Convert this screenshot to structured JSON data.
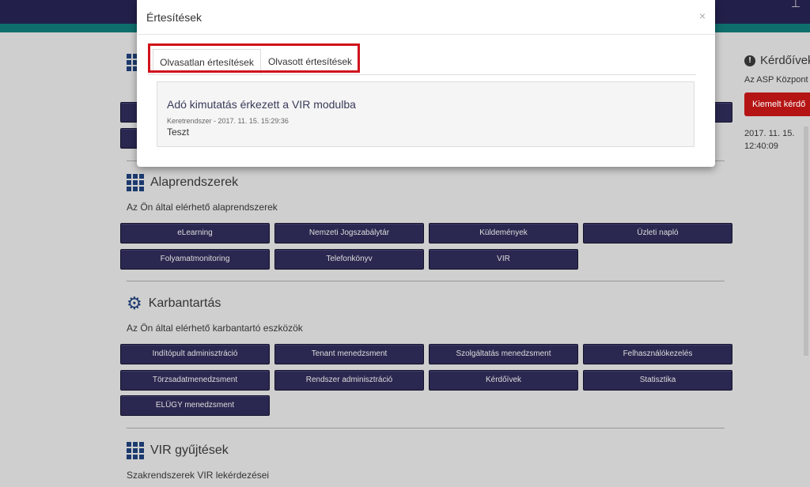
{
  "modal": {
    "title": "Értesítések",
    "close": "×",
    "tabs": [
      {
        "label": "Olvasatlan értesítések"
      },
      {
        "label": "Olvasott értesítések"
      }
    ],
    "notification": {
      "title": "Adó kimutatás érkezett a VIR modulba",
      "meta": "Keretrendszer - 2017. 11. 15. 15:29:36",
      "body": "Teszt"
    }
  },
  "sections": {
    "alaprendszerek": {
      "title": "Alaprendszerek",
      "desc": "Az Ön által elérhető alaprendszerek",
      "buttons": [
        "eLearning",
        "Nemzeti Jogszabálytár",
        "Küldemények",
        "Üzleti napló",
        "Folyamatmonitoring",
        "Telefonkönyv",
        "VIR"
      ]
    },
    "karbantartas": {
      "title": "Karbantartás",
      "desc": "Az Ön által elérhető karbantartó eszközök",
      "buttons": [
        "Indítópult adminisztráció",
        "Tenant menedzsment",
        "Szolgáltatás menedzsment",
        "Felhasználókezelés",
        "Törzsadatmenedzsment",
        "Rendszer adminisztráció",
        "Kérdőívek",
        "Statisztika",
        "ELÜGY menedzsment"
      ]
    },
    "vir": {
      "title": "VIR gyűjtések",
      "desc": "Szakrendszerek VIR lekérdezései"
    }
  },
  "right_panel": {
    "title": "Kérdőívek",
    "desc": "Az ASP Központ",
    "button": "Kiemelt kérdő",
    "date_line1": "2017. 11. 15.",
    "date_line2": "12:40:09"
  },
  "colors": {
    "nav": "#22204a",
    "accent": "#0e6e6c",
    "button": "#2a2850",
    "highlight": "#d0121c",
    "red_button": "#b51414"
  }
}
